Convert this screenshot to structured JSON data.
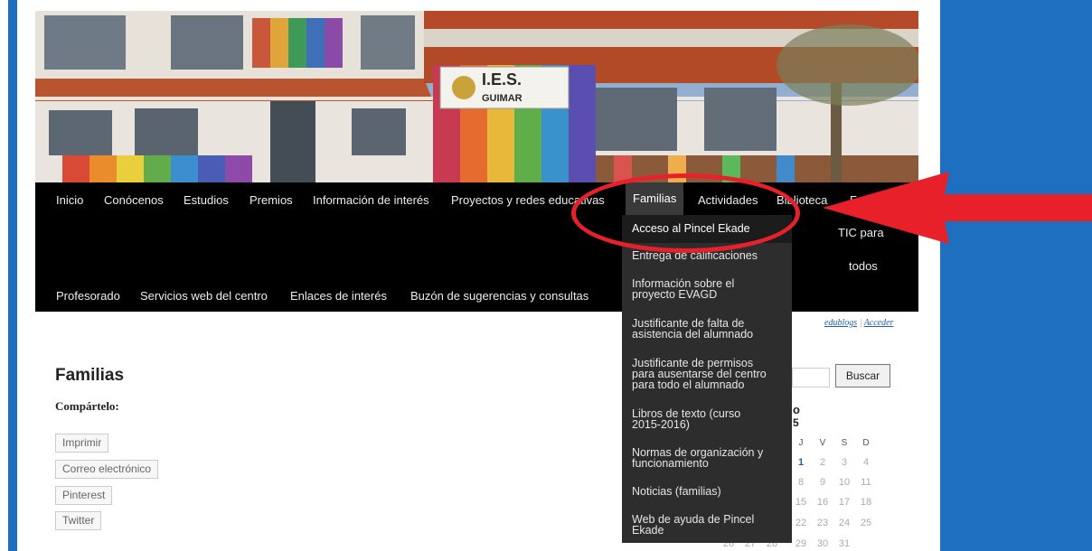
{
  "header": {
    "sign_line1": "I.E.S.",
    "sign_line2": "GUIMAR"
  },
  "nav": {
    "row1": [
      "Inicio",
      "Conócenos",
      "Estudios",
      "Premios",
      "Información de interés",
      "Proyectos y redes educativas"
    ],
    "active": "Familias",
    "row1_right": [
      "Actividades",
      "Biblioteca",
      "Formación"
    ],
    "tic_line1": "TIC para",
    "tic_line2": "todos",
    "row2": [
      "Profesorado",
      "Servicios web del centro",
      "Enlaces de interés",
      "Buzón de sugerencias y consultas"
    ]
  },
  "dropdown": [
    [
      "Acceso al Pincel Ekade"
    ],
    [
      "Entrega de calificaciones"
    ],
    [
      "Información sobre el",
      "proyecto EVAGD"
    ],
    [
      "Justificante de falta de",
      "asistencia del alumnado"
    ],
    [
      "Justificante de permisos",
      "para ausentarse del centro",
      "para todo el alumnado"
    ],
    [
      "Libros de texto (curso",
      "2015-2016)"
    ],
    [
      "Normas de organización y",
      "funcionamiento"
    ],
    [
      "Noticias (familias)"
    ],
    [
      "Web de ayuda de Pincel",
      "Ekade"
    ]
  ],
  "top_links": {
    "edublogs": "edublogs",
    "separator": "|",
    "acceder": "Acceder"
  },
  "main": {
    "title": "Familias",
    "share_label": "Compártelo:",
    "share_buttons": [
      "Imprimir",
      "Correo electrónico",
      "Pinterest",
      "Twitter"
    ]
  },
  "sidebar": {
    "search_button": "Buscar",
    "calendar_title_1": "o",
    "calendar_title_2": "5",
    "calendar_days": [
      "J",
      "V",
      "S",
      "D"
    ],
    "calendar_rows": [
      [
        "1",
        "2",
        "3",
        "4"
      ],
      [
        "8",
        "9",
        "10",
        "11"
      ],
      [
        "15",
        "16",
        "17",
        "18"
      ],
      [
        "22",
        "23",
        "24",
        "25"
      ],
      [
        "26",
        "27",
        "28",
        "29",
        "30",
        "31"
      ]
    ]
  },
  "annotation": {
    "circle_color": "#e8202a",
    "arrow_color": "#e8202a"
  },
  "colors": {
    "side_blue": "#1f6fc1",
    "nav_bg": "#000000",
    "dropdown_bg": "#2d2d2d"
  }
}
